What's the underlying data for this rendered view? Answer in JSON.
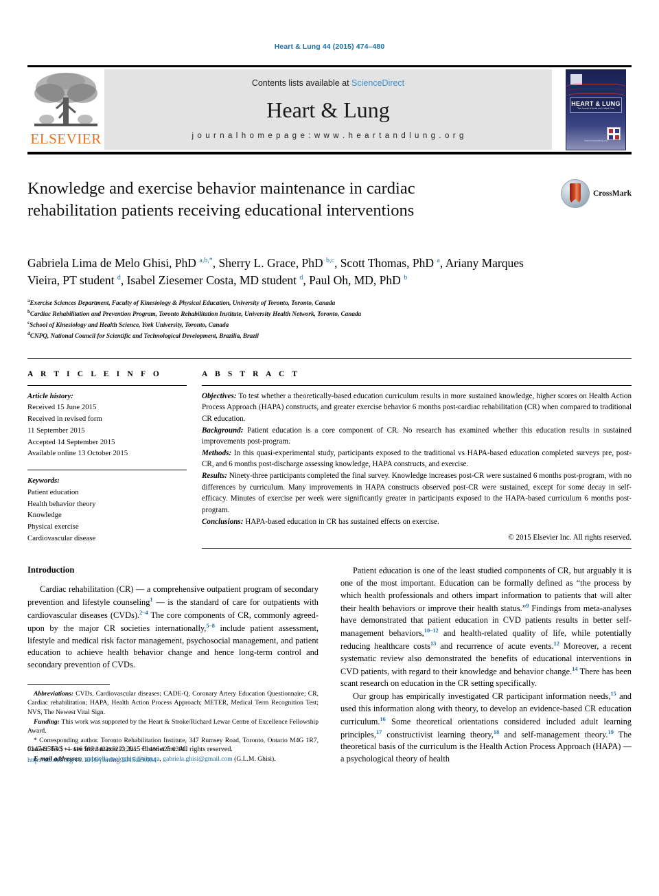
{
  "running_head": "Heart & Lung 44 (2015) 474–480",
  "masthead": {
    "contents_prefix": "Contents lists available at ",
    "sciencedirect": "ScienceDirect",
    "journal_name": "Heart & Lung",
    "homepage": "j o u r n a l   h o m e p a g e :   w w w . h e a r t a n d l u n g . o r g",
    "elsevier_wordmark": "ELSEVIER",
    "cover_title": "HEART & LUNG",
    "cover_subtitle": "The Journal of Acute and Critical Care",
    "cover_url": "www.heartandlung.org",
    "sciencedirect_color": "#3a8fd0",
    "elsevier_orange": "#E9711C"
  },
  "article": {
    "title": "Knowledge and exercise behavior maintenance in cardiac rehabilitation patients receiving educational interventions",
    "crossmark_label": "CrossMark",
    "authors": [
      {
        "name": "Gabriela Lima de Melo Ghisi, PhD ",
        "sup": "a,b,*",
        "sep": ", "
      },
      {
        "name": "Sherry L. Grace, PhD ",
        "sup": "b,c",
        "sep": ", "
      },
      {
        "name": "Scott Thomas, PhD ",
        "sup": "a",
        "sep": ", "
      },
      {
        "name": "Ariany Marques Vieira, PT student ",
        "sup": "d",
        "sep": ", "
      },
      {
        "name": "Isabel Ziesemer Costa, MD student ",
        "sup": "d",
        "sep": ", "
      },
      {
        "name": "Paul Oh, MD, PhD ",
        "sup": "b",
        "sep": ""
      }
    ],
    "affiliations": [
      {
        "marker": "a",
        "text": "Exercise Sciences Department, Faculty of Kinesiology & Physical Education, University of Toronto, Toronto, Canada"
      },
      {
        "marker": "b",
        "text": "Cardiac Rehabilitation and Prevention Program, Toronto Rehabilitation Institute, University Health Network, Toronto, Canada"
      },
      {
        "marker": "c",
        "text": "School of Kinesiology and Health Science, York University, Toronto, Canada"
      },
      {
        "marker": "d",
        "text": "CNPQ, National Council for Scientific and Technological Development, Brazilia, Brazil"
      }
    ]
  },
  "article_info": {
    "heading": "A R T I C L E   I N F O",
    "history_label": "Article history:",
    "history": [
      "Received 15 June 2015",
      "Received in revised form",
      "11 September 2015",
      "Accepted 14 September 2015",
      "Available online 13 October 2015"
    ],
    "keywords_label": "Keywords:",
    "keywords": [
      "Patient education",
      "Health behavior theory",
      "Knowledge",
      "Physical exercise",
      "Cardiovascular disease"
    ]
  },
  "abstract": {
    "heading": "A B S T R A C T",
    "sections": [
      {
        "label": "Objectives:",
        "text": " To test whether a theoretically-based education curriculum results in more sustained knowledge, higher scores on Health Action Process Approach (HAPA) constructs, and greater exercise behavior 6 months post-cardiac rehabilitation (CR) when compared to traditional CR education."
      },
      {
        "label": "Background:",
        "text": " Patient education is a core component of CR. No research has examined whether this education results in sustained improvements post-program."
      },
      {
        "label": "Methods:",
        "text": " In this quasi-experimental study, participants exposed to the traditional vs HAPA-based education completed surveys pre, post-CR, and 6 months post-discharge assessing knowledge, HAPA constructs, and exercise."
      },
      {
        "label": "Results:",
        "text": " Ninety-three participants completed the final survey. Knowledge increases post-CR were sustained 6 months post-program, with no differences by curriculum. Many improvements in HAPA constructs observed post-CR were sustained, except for some decay in self-efficacy. Minutes of exercise per week were significantly greater in participants exposed to the HAPA-based curriculum 6 months post-program."
      },
      {
        "label": "Conclusions:",
        "text": " HAPA-based education in CR has sustained effects on exercise."
      }
    ],
    "copyright": "© 2015 Elsevier Inc. All rights reserved."
  },
  "body": {
    "intro_heading": "Introduction",
    "left_paragraphs": [
      {
        "runs": [
          {
            "t": "Cardiac rehabilitation (CR) — a comprehensive outpatient program of secondary prevention and lifestyle counseling"
          },
          {
            "t": "1",
            "ref": true
          },
          {
            "t": " — is the standard of care for outpatients with cardiovascular diseases (CVDs)."
          },
          {
            "t": "2–4",
            "ref": true
          },
          {
            "t": " The core components of CR, commonly agreed-upon by the major CR societies internationally,"
          },
          {
            "t": "5–8",
            "ref": true
          },
          {
            "t": " include patient assessment, lifestyle and medical risk factor management, psychosocial management, and patient education to achieve health behavior change and hence long-term control and secondary prevention of CVDs."
          }
        ]
      }
    ],
    "right_paragraphs": [
      {
        "runs": [
          {
            "t": "Patient education is one of the least studied components of CR, but arguably it is one of the most important. Education can be formally defined as “the process by which health professionals and others impart information to patients that will alter their health behaviors or improve their health status.”"
          },
          {
            "t": "9",
            "ref": true
          },
          {
            "t": " Findings from meta-analyses have demonstrated that patient education in CVD patients results in better self-management behaviors,"
          },
          {
            "t": "10–12",
            "ref": true
          },
          {
            "t": " and health-related quality of life, while potentially reducing healthcare costs"
          },
          {
            "t": "13",
            "ref": true
          },
          {
            "t": " and recurrence of acute events."
          },
          {
            "t": "12",
            "ref": true
          },
          {
            "t": " Moreover, a recent systematic review also demonstrated the benefits of educational interventions in CVD patients, with regard to their knowledge and behavior change."
          },
          {
            "t": "14",
            "ref": true
          },
          {
            "t": " There has been scant research on education in the CR setting specifically."
          }
        ]
      },
      {
        "runs": [
          {
            "t": "Our group has empirically investigated CR participant information needs,"
          },
          {
            "t": "15",
            "ref": true
          },
          {
            "t": " and used this information along with theory, to develop an evidence-based CR education curriculum."
          },
          {
            "t": "16",
            "ref": true
          },
          {
            "t": " Some theoretical orientations considered included adult learning principles,"
          },
          {
            "t": "17",
            "ref": true
          },
          {
            "t": " constructivist learning theory,"
          },
          {
            "t": "18",
            "ref": true
          },
          {
            "t": " and self-management theory."
          },
          {
            "t": "19",
            "ref": true
          },
          {
            "t": " The theoretical basis of the curriculum is the Health Action Process Approach (HAPA) — a psychological theory of health"
          }
        ]
      }
    ]
  },
  "footnotes": {
    "abbreviations_label": "Abbreviations:",
    "abbreviations_text": " CVDs, Cardiovascular diseases; CADE-Q, Coronary Artery Education Questionnaire; CR, Cardiac rehabilitation; HAPA, Health Action Process Approach; METER, Medical Term Recognition Test; NVS, The Newest Vital Sign.",
    "funding_label": "Funding:",
    "funding_text": " This work was supported by the Heart & Stroke/Richard Lewar Centre of Excellence Fellowship Award.",
    "corresponding_text": "* Corresponding author. Toronto Rehabilitation Institute, 347 Rumsey Road, Toronto, Ontario M4G 1R7, Canada. Tel.: +1 416 597 3422x5223; fax: +1 416 425 0301.",
    "email_label": "E-mail addresses:",
    "email_1": "gabriella.meloghisi@uhn.ca",
    "email_sep": ", ",
    "email_2": "gabriela.ghisi@gmail.com",
    "email_attrib": "(G.L.M. Ghisi).",
    "link_color": "#1c6ea4"
  },
  "issn_line": {
    "text_before": "0147-9563/$ — see front matter © 2015 Elsevier Inc. All rights reserved.",
    "doi": "http://dx.doi.org/10.1016/j.hrtlng.2015.09.004"
  }
}
